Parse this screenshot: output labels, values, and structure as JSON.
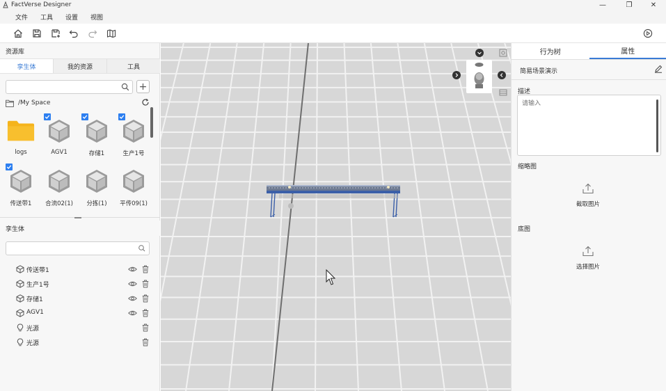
{
  "window": {
    "title": "FactVerse Designer",
    "min": "—",
    "restore": "❐",
    "close": "✕"
  },
  "menu": [
    "文件",
    "工具",
    "设置",
    "视图"
  ],
  "toolbar": {
    "items": [
      "home-icon",
      "save-icon",
      "save-as-icon",
      "undo-icon",
      "redo-icon",
      "map-icon"
    ],
    "play": "play-icon"
  },
  "resources": {
    "title": "资源库",
    "tabs": [
      "孪生体",
      "我的资源",
      "工具"
    ],
    "active_tab": 0,
    "search_placeholder": "",
    "add_label": "+",
    "path": "/My Space",
    "assets": [
      {
        "label": "logs",
        "kind": "folder",
        "checked": false
      },
      {
        "label": "AGV1",
        "kind": "cube",
        "checked": true
      },
      {
        "label": "存储1",
        "kind": "cube",
        "checked": true
      },
      {
        "label": "生产1号",
        "kind": "cube",
        "checked": true
      },
      {
        "label": "传送带1",
        "kind": "cube",
        "checked": true
      },
      {
        "label": "合流02(1)",
        "kind": "cube",
        "checked": false
      },
      {
        "label": "分拣(1)",
        "kind": "cube",
        "checked": false
      },
      {
        "label": "平传09(1)",
        "kind": "cube",
        "checked": false
      }
    ]
  },
  "twins": {
    "title": "孪生体",
    "search_placeholder": "",
    "items": [
      {
        "label": "传送带1",
        "icon": "twin-cube-icon",
        "eye": true
      },
      {
        "label": "生产1号",
        "icon": "twin-cube-icon",
        "eye": true
      },
      {
        "label": "存储1",
        "icon": "twin-cube-icon",
        "eye": true
      },
      {
        "label": "AGV1",
        "icon": "twin-cube-icon",
        "eye": true
      },
      {
        "label": "光源",
        "icon": "bulb-icon",
        "eye": false
      },
      {
        "label": "光源",
        "icon": "bulb-icon",
        "eye": false
      }
    ]
  },
  "properties": {
    "tabs": [
      "行为树",
      "属性"
    ],
    "active_tab": 1,
    "scene_name": "简易场景演示",
    "desc_label": "描述",
    "desc_placeholder": "请输入",
    "thumb_label": "缩略图",
    "thumb_action": "截取图片",
    "base_label": "底图",
    "base_action": "选择图片"
  },
  "colors": {
    "accent": "#3a7bd5",
    "check": "#2d7ff0",
    "folder": "#f5b41c",
    "conveyor": "#3b5fa8"
  }
}
